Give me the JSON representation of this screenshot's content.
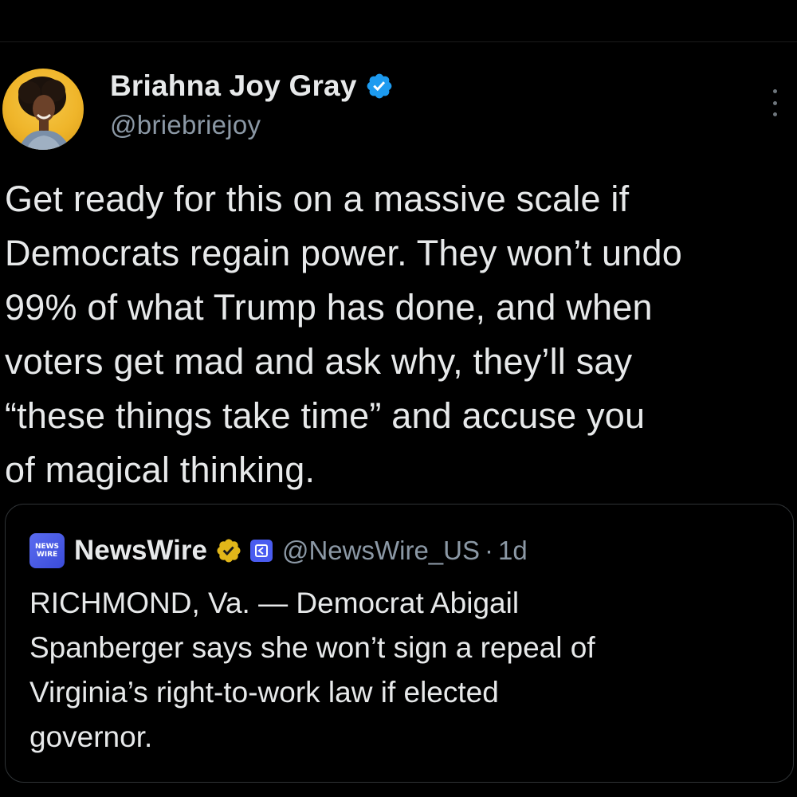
{
  "author": {
    "display_name": "Briahna Joy Gray",
    "handle": "@briebriejoy",
    "avatar_icon": "profile-photo",
    "verified_icon": "verified-badge-icon",
    "verified_color": "#1d9bf0"
  },
  "more_icon": "more-options-icon",
  "tweet": {
    "text": "Get ready for this on a massive scale if\nDemocrats regain power. They won’t undo\n99% of what Trump has done, and when\nvoters get mad and ask why, they’ll say\n“these things take time” and accuse you\nof magical thinking."
  },
  "quote": {
    "logo_line1": "NEWS",
    "logo_line2": "WIRE",
    "display_name": "NewsWire",
    "verified_icon": "gold-verified-badge-icon",
    "verified_color": "#e2b719",
    "affiliate_icon": "affiliate-badge-icon",
    "handle": "@NewsWire_US",
    "separator": "·",
    "time": "1d",
    "text": "RICHMOND, Va. — Democrat Abigail\nSpanberger says she won’t sign a repeal of\nVirginia’s right-to-work law if elected\ngovernor."
  },
  "colors": {
    "background": "#000000",
    "text": "#e7e9ea",
    "secondary_text": "#8b98a5",
    "border": "#2f3336"
  }
}
